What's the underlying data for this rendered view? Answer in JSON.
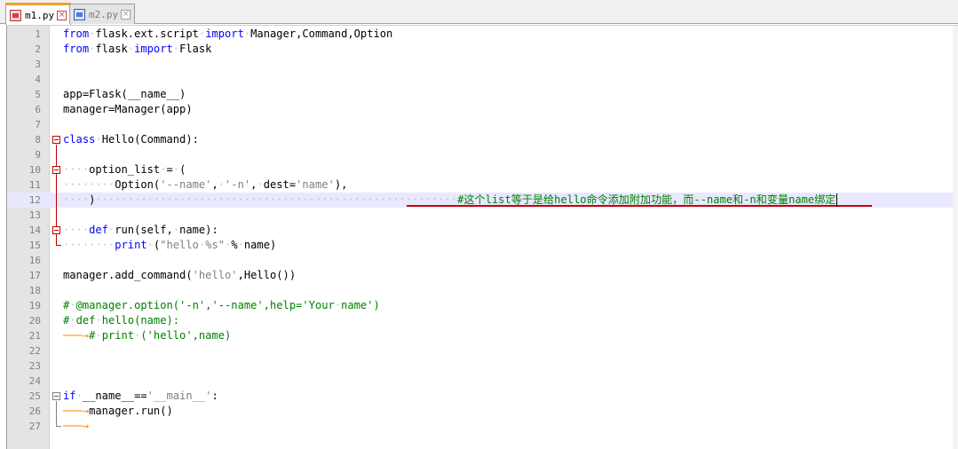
{
  "tabs": [
    {
      "label": "m1.py",
      "active": true
    },
    {
      "label": "m2.py",
      "active": false
    }
  ],
  "lines": [
    {
      "num": "1",
      "html": "<span class=\"kw\">from</span><span class=\"ws\">·</span>flask.ext.script<span class=\"ws\">·</span><span class=\"kw\">import</span><span class=\"ws\">·</span>Manager,Command,Option"
    },
    {
      "num": "2",
      "html": "<span class=\"kw\">from</span><span class=\"ws\">·</span>flask<span class=\"ws\">·</span><span class=\"kw\">import</span><span class=\"ws\">·</span>Flask"
    },
    {
      "num": "3",
      "html": ""
    },
    {
      "num": "4",
      "html": ""
    },
    {
      "num": "5",
      "html": "app=Flask(__name__)"
    },
    {
      "num": "6",
      "html": "manager=Manager(app)"
    },
    {
      "num": "7",
      "html": ""
    },
    {
      "num": "8",
      "html": "<span class=\"kw\">class</span><span class=\"ws\">·</span>Hello(Command):"
    },
    {
      "num": "9",
      "html": ""
    },
    {
      "num": "10",
      "html": "<span class=\"ws\">····</span>option_list<span class=\"ws\">·</span>=<span class=\"ws\">·</span>("
    },
    {
      "num": "11",
      "html": "<span class=\"ws\">········</span>Option(<span class=\"str\">'--name'</span>,<span class=\"ws\">·</span><span class=\"str\">'-n'</span>,<span class=\"ws\">·</span>dest=<span class=\"str\">'name'</span>),"
    },
    {
      "num": "12",
      "html": "<span class=\"ws\">····</span>)<span class=\"ws\">························································</span><span class=\"cm\">#这个list等于是给hello命令添加附加功能，而--name和-n和变量name绑定</span>"
    },
    {
      "num": "13",
      "html": ""
    },
    {
      "num": "14",
      "html": "<span class=\"ws\">····</span><span class=\"kw\">def</span><span class=\"ws\">·</span>run(self,<span class=\"ws\">·</span>name):"
    },
    {
      "num": "15",
      "html": "<span class=\"ws\">········</span><span class=\"kw\">print</span><span class=\"ws\">·</span>(<span class=\"str\">\"hello<span class=\"ws\">·</span>%s\"</span><span class=\"ws\">·</span>%<span class=\"ws\">·</span>name)"
    },
    {
      "num": "16",
      "html": ""
    },
    {
      "num": "17",
      "html": "manager.add_command(<span class=\"str\">'hello'</span>,Hello())"
    },
    {
      "num": "18",
      "html": ""
    },
    {
      "num": "19",
      "html": "<span class=\"cm\">#<span class=\"ws\">·</span>@manager.option('-n','--name',help='Your<span class=\"ws\">·</span>name')</span>"
    },
    {
      "num": "20",
      "html": "<span class=\"cm\">#<span class=\"ws\">·</span>def<span class=\"ws\">·</span>hello(name):</span>"
    },
    {
      "num": "21",
      "html": "<span class=\"tabarrow\">───→</span><span class=\"cm\">#<span class=\"ws\">·</span>print<span class=\"ws\">·</span>('hello',name)</span>"
    },
    {
      "num": "22",
      "html": ""
    },
    {
      "num": "23",
      "html": ""
    },
    {
      "num": "24",
      "html": ""
    },
    {
      "num": "25",
      "html": "<span class=\"kw\">if</span><span class=\"ws\">·</span>__name__==<span class=\"str\">'__main__'</span>:"
    },
    {
      "num": "26",
      "html": "<span class=\"tabarrow\">───→</span>manager.run()"
    },
    {
      "num": "27",
      "html": "<span class=\"tabarrow\">───→</span>"
    }
  ]
}
